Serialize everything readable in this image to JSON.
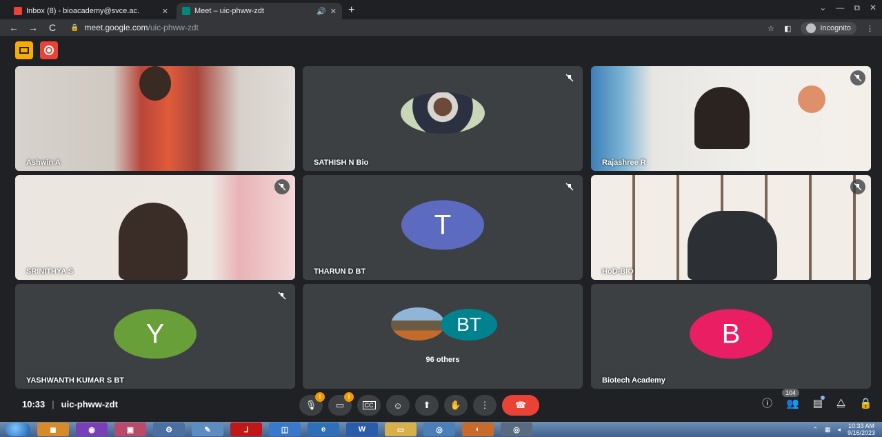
{
  "browser": {
    "tabs": [
      {
        "title": "Inbox (8) - bioacademy@svce.ac.",
        "close": "✕",
        "favicon_color": "#ea4335"
      },
      {
        "title": "Meet – uic-phww-zdt",
        "close": "✕",
        "audio": "🔊",
        "favicon_color": "#00897b"
      }
    ],
    "new_tab": "+",
    "window_controls": [
      "⌄",
      "—",
      "⧉",
      "✕"
    ],
    "nav": {
      "back": "←",
      "forward": "→",
      "reload": "C"
    },
    "url_host": "meet.google.com",
    "url_path": "/uic-phww-zdt",
    "incognito_label": "Incognito"
  },
  "tiles": [
    {
      "name": "Ashwin A",
      "type": "video",
      "muted": false
    },
    {
      "name": "SATHISH N Bio",
      "type": "photo-avatar",
      "muted": true
    },
    {
      "name": "Rajashree R",
      "type": "video",
      "muted": true
    },
    {
      "name": "SRINITHYA S",
      "type": "video",
      "muted": true
    },
    {
      "name": "THARUN D BT",
      "type": "letter",
      "letter": "T",
      "color": "#5c6bc0",
      "muted": true
    },
    {
      "name": "HoD-BIO",
      "type": "video",
      "muted": true
    },
    {
      "name": "YASHWANTH KUMAR S BT",
      "type": "letter",
      "letter": "Y",
      "color": "#689f38",
      "muted": true
    },
    {
      "name": "96 others",
      "type": "others",
      "letter": "BT",
      "color": "#00838f",
      "muted": false
    },
    {
      "name": "Biotech Academy",
      "type": "letter",
      "letter": "B",
      "color": "#e91e63",
      "muted": false
    }
  ],
  "meeting": {
    "time": "10:33",
    "separator": "|",
    "code": "uic-phww-zdt"
  },
  "controls": [
    "mic-off",
    "camera-off",
    "captions",
    "emoji",
    "present",
    "raise-hand",
    "more",
    "end-call"
  ],
  "side": {
    "people_count": "104"
  },
  "taskbar": {
    "clock_time": "10:33 AM",
    "clock_date": "9/16/2023"
  }
}
